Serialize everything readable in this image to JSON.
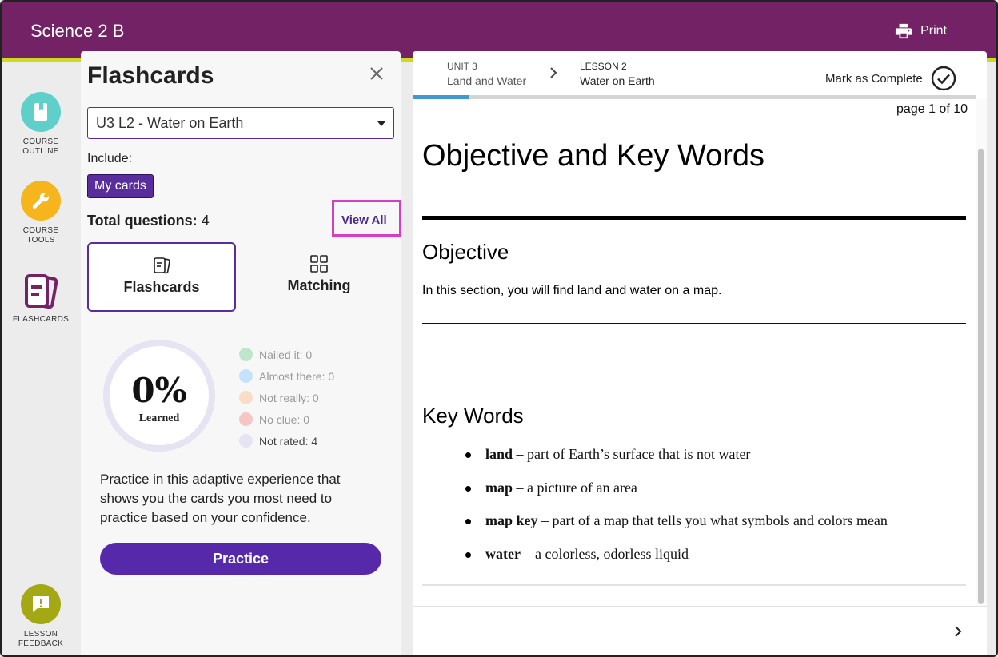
{
  "app": {
    "title": "Science 2 B",
    "print_label": "Print"
  },
  "rail": {
    "course_outline": {
      "line1": "COURSE",
      "line2": "OUTLINE",
      "color": "#5ecfc9"
    },
    "course_tools": {
      "line1": "COURSE",
      "line2": "TOOLS",
      "color": "#f6b51c"
    },
    "flashcards": {
      "line1": "FLASHCARDS",
      "color": "#722265"
    },
    "lesson_feedback": {
      "line1": "LESSON",
      "line2": "FEEDBACK",
      "color": "#a3a814"
    }
  },
  "flashcards_panel": {
    "title": "Flashcards",
    "deck_select": "U3 L2 - Water on Earth",
    "include_label": "Include:",
    "chip_label": "My cards",
    "total_label": "Total questions:",
    "total_value": "4",
    "view_all": "View All",
    "modes": [
      {
        "label": "Flashcards",
        "icon": "flashcards-icon",
        "active": true
      },
      {
        "label": "Matching",
        "icon": "grid-icon",
        "active": false
      }
    ],
    "progress": {
      "percent": "0%",
      "label": "Learned",
      "fraction": 0
    },
    "legend": [
      {
        "label": "Nailed it: 0",
        "color": "#bfe6cc"
      },
      {
        "label": "Almost there: 0",
        "color": "#c6e1fb"
      },
      {
        "label": "Not really: 0",
        "color": "#fbdcc6"
      },
      {
        "label": "No clue: 0",
        "color": "#f6c6c6"
      },
      {
        "label": "Not rated: 4",
        "color": "#e6e3f2"
      }
    ],
    "description": "Practice in this adaptive experience that shows you the cards you most need to practice based on your confidence.",
    "practice_label": "Practice"
  },
  "content": {
    "breadcrumb": {
      "unit_kicker": "UNIT 3",
      "unit_title": "Land and Water",
      "lesson_kicker": "LESSON 2",
      "lesson_title": "Water on Earth"
    },
    "mark_complete": "Mark as Complete",
    "progress_fraction": 0.1,
    "page_indicator": "page 1 of 10",
    "heading": "Objective and Key Words",
    "objective_heading": "Objective",
    "objective_text": "In this section, you will find land and water on a map.",
    "keywords_heading": "Key Words",
    "keywords": [
      {
        "term": "land",
        "definition": " – part of Earth’s surface that is not water"
      },
      {
        "term": "map",
        "definition": " – a picture of an area"
      },
      {
        "term": "map key",
        "definition": " – part of a map that tells you what symbols and colors mean"
      },
      {
        "term": "water",
        "definition": " – a colorless, odorless liquid"
      }
    ]
  }
}
